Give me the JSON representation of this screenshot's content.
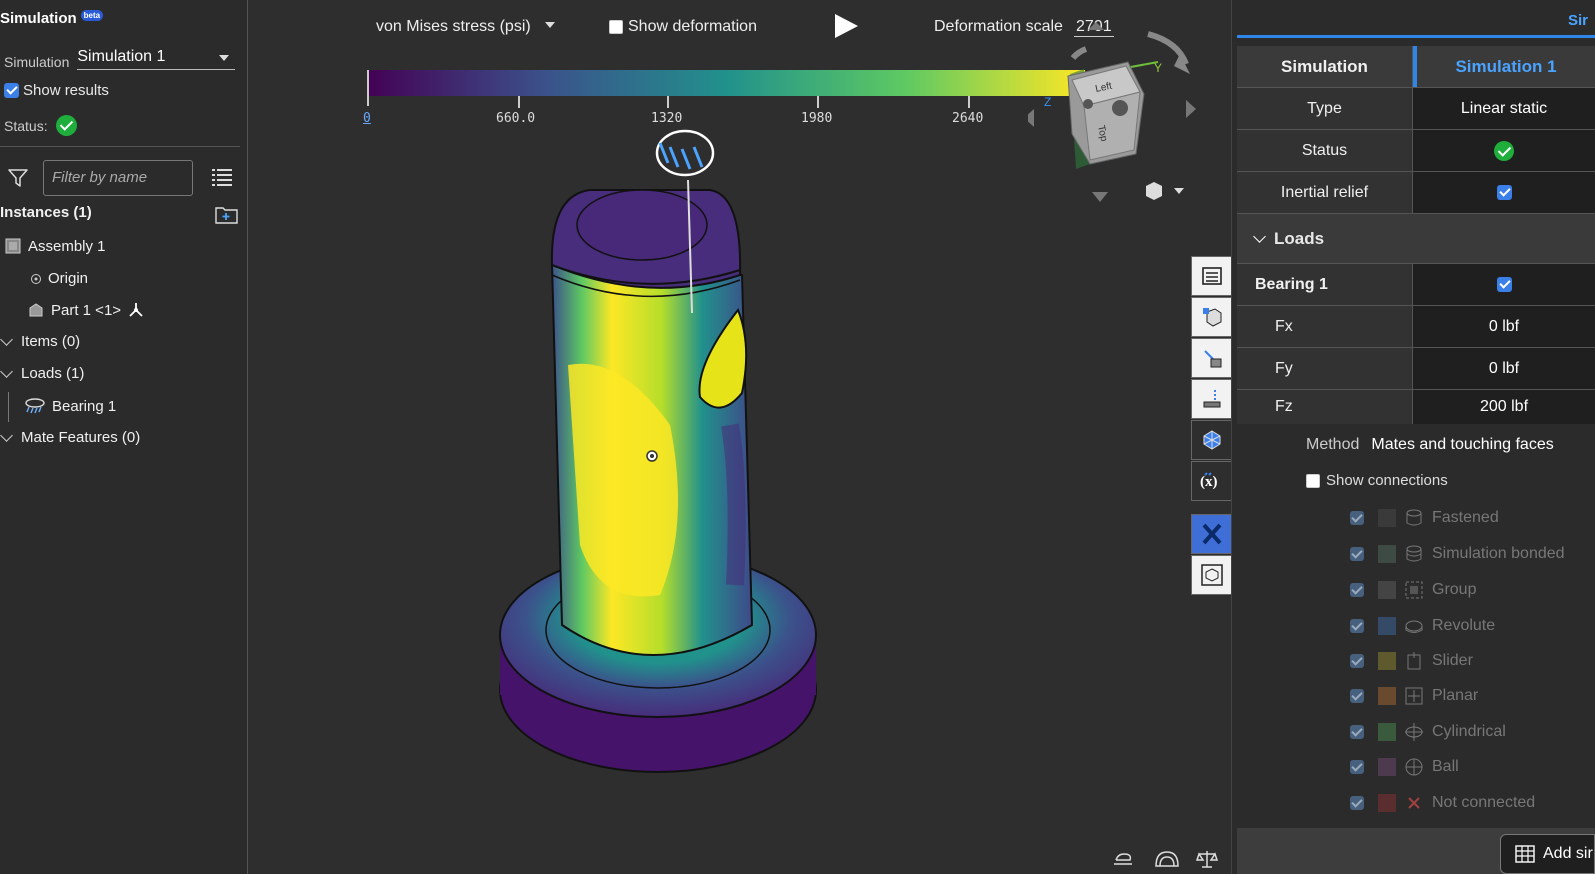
{
  "left_panel": {
    "title": "Simulation",
    "beta": "beta",
    "simulation_label": "Simulation",
    "simulation_value": "Simulation 1",
    "show_results": "Show results",
    "status_label": "Status:",
    "filter_placeholder": "Filter by name",
    "instances": "Instances (1)",
    "assembly": "Assembly 1",
    "origin": "Origin",
    "part": "Part 1 <1>",
    "items": "Items (0)",
    "loads": "Loads (1)",
    "bearing": "Bearing 1",
    "mate_features": "Mate Features (0)"
  },
  "viewport": {
    "result_type": "von Mises stress (psi)",
    "show_deformation": "Show deformation",
    "deformation_scale_label": "Deformation scale",
    "deformation_scale_value": "2701",
    "colorbar_ticks": [
      "0",
      "660.0",
      "1320",
      "1980",
      "2640"
    ],
    "colormap": [
      "#440154",
      "#3b528b",
      "#21918c",
      "#5ec962",
      "#fde725"
    ]
  },
  "right_panel": {
    "tab": "Sir",
    "header_left": "Simulation",
    "header_right": "Simulation 1",
    "rows": [
      {
        "label": "Type",
        "value": "Linear static"
      },
      {
        "label": "Status",
        "value": ""
      },
      {
        "label": "Inertial relief",
        "value": ""
      }
    ],
    "loads_label": "Loads",
    "bearing_label": "Bearing 1",
    "forces": [
      {
        "label": "Fx",
        "value": "0 lbf"
      },
      {
        "label": "Fy",
        "value": "0 lbf"
      },
      {
        "label": "Fz",
        "value": "200 lbf"
      }
    ],
    "method_label": "Method",
    "method_value": "Mates and touching faces",
    "show_connections": "Show connections",
    "connections": [
      {
        "name": "Fastened",
        "color": "#3a3a3a"
      },
      {
        "name": "Simulation bonded",
        "color": "#3e4a44"
      },
      {
        "name": "Group",
        "color": "#444444"
      },
      {
        "name": "Revolute",
        "color": "#354a66"
      },
      {
        "name": "Slider",
        "color": "#5e5a2e"
      },
      {
        "name": "Planar",
        "color": "#6a4a2e"
      },
      {
        "name": "Cylindrical",
        "color": "#3a5a3e"
      },
      {
        "name": "Ball",
        "color": "#4e3a4e"
      },
      {
        "name": "Not connected",
        "color": "#5a2e2e"
      }
    ],
    "add_button": "Add sir"
  }
}
